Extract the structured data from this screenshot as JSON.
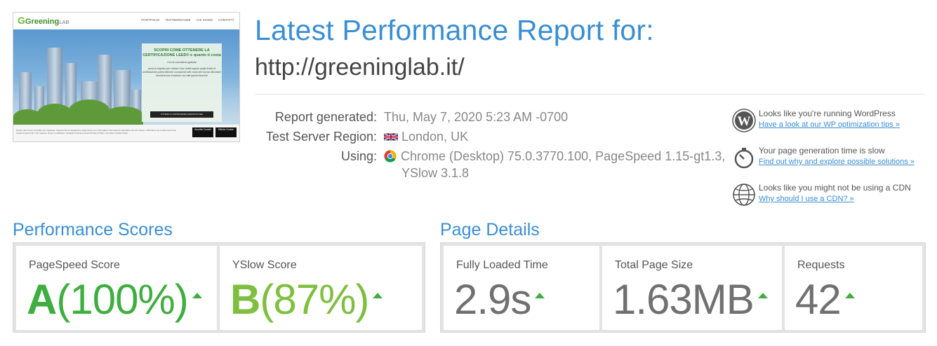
{
  "thumbnail": {
    "logo": "Greening",
    "logo_suffix": "LAB",
    "menu": [
      "PORTFOLIO",
      "TESTIMONIANZE",
      "CHI SIAMO",
      "CONTATTI"
    ],
    "hero_heading": "SCOPRI COME OTTENERE LA CERTIFICAZIONE LEED® e quanto ti costa",
    "hero_sub": "Con la consulenza gratuita",
    "hero_text": "avrai un esperto per chiarire i tuoi dubbi sapere quale livello di certificazione potrai ottenere conoscerai tutti i costi che dovrai affrontare riceverai una soluzione con tutti questi elementi",
    "hero_button": "OTTIENI LA CONSULENZA GRATUITA ORA",
    "footer_text": "Questo sito fa uso di cookie per migliorare l'esperienza di navigazione degli utenti e per raccogliere informazioni sull'utilizzo del sito stesso. Utilizziamo sia cookie tecnici sia cookie di parti terze. Per saperne di più e modificare i dettagli consulta la nostra Privacy Policy e la nostra Cookie Policy.",
    "footer_btn1": "Accetta Cookie",
    "footer_btn2": "Rifiuta Cookie"
  },
  "header": {
    "title": "Latest Performance Report for:",
    "url": "http://greeninglab.it/"
  },
  "info": {
    "report_label": "Report generated:",
    "report_value": "Thu, May 7, 2020 5:23 AM -0700",
    "region_label": "Test Server Region:",
    "region_value": "London, UK",
    "using_label": "Using:",
    "using_value_line1": "Chrome (Desktop) 75.0.3770.100, PageSpeed 1.15-gt1.3,",
    "using_value_line2": "YSlow 3.1.8"
  },
  "notices": [
    {
      "icon": "wordpress-icon",
      "text": "Looks like you're running WordPress",
      "link": "Have a look at our WP optimization tips »"
    },
    {
      "icon": "stopwatch-icon",
      "text": "Your page generation time is slow",
      "link": "Find out why and explore possible solutions »"
    },
    {
      "icon": "globe-icon",
      "text": "Looks like you might not be using a CDN",
      "link": "Why should I use a CDN? »"
    }
  ],
  "performance": {
    "title": "Performance Scores",
    "pagespeed": {
      "label": "PageSpeed Score",
      "grade": "A",
      "percent": "(100%)"
    },
    "yslow": {
      "label": "YSlow Score",
      "grade": "B",
      "percent": "(87%)"
    }
  },
  "details": {
    "title": "Page Details",
    "load_time": {
      "label": "Fully Loaded Time",
      "value": "2.9s"
    },
    "page_size": {
      "label": "Total Page Size",
      "value": "1.63MB"
    },
    "requests": {
      "label": "Requests",
      "value": "42"
    }
  },
  "colors": {
    "accent": "#3a8ed3",
    "grade_a": "#3fae3f",
    "grade_b": "#7fbf3f",
    "arrow": "#3fae3f",
    "value_gray": "#707070"
  }
}
